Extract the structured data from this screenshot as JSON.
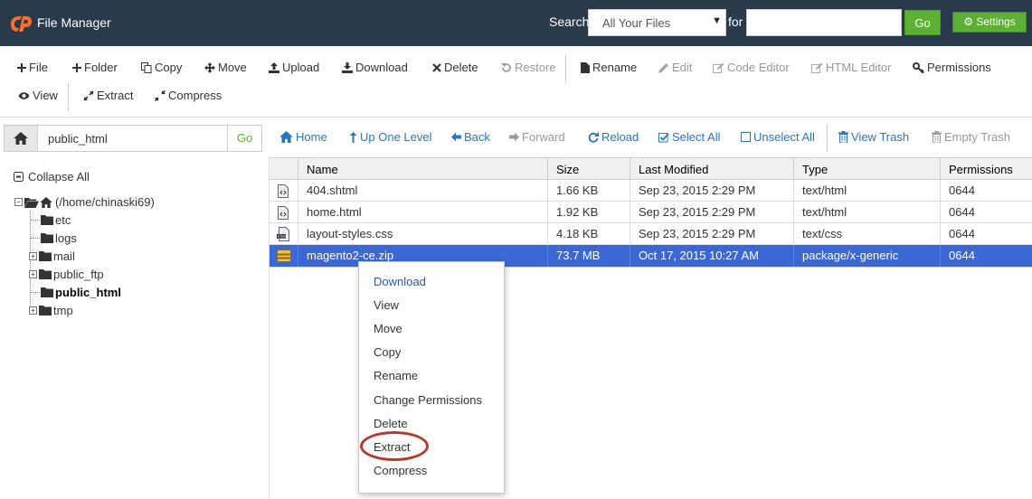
{
  "header": {
    "app_title": "File Manager",
    "search_label": "Search",
    "search_scope": "All Your Files",
    "for_label": "for",
    "search_value": "",
    "go_label": "Go",
    "settings_label": "Settings"
  },
  "toolbar": {
    "file": "File",
    "folder": "Folder",
    "copy": "Copy",
    "move": "Move",
    "upload": "Upload",
    "download": "Download",
    "delete": "Delete",
    "restore": "Restore",
    "rename": "Rename",
    "edit": "Edit",
    "code_editor": "Code Editor",
    "html_editor": "HTML Editor",
    "permissions": "Permissions",
    "view": "View",
    "extract": "Extract",
    "compress": "Compress"
  },
  "pathbar": {
    "path_value": "public_html",
    "go_label": "Go"
  },
  "nav": {
    "home": "Home",
    "up_one_level": "Up One Level",
    "back": "Back",
    "forward": "Forward",
    "reload": "Reload",
    "select_all": "Select All",
    "unselect_all": "Unselect All",
    "view_trash": "View Trash",
    "empty_trash": "Empty Trash"
  },
  "sidebar": {
    "collapse_all": "Collapse All",
    "root": "(/home/chinaski69)",
    "items": [
      {
        "label": "etc"
      },
      {
        "label": "logs"
      },
      {
        "label": "mail"
      },
      {
        "label": "public_ftp"
      },
      {
        "label": "public_html"
      },
      {
        "label": "tmp"
      }
    ]
  },
  "table": {
    "columns": [
      "Name",
      "Size",
      "Last Modified",
      "Type",
      "Permissions"
    ],
    "rows": [
      {
        "name": "404.shtml",
        "size": "1.66 KB",
        "modified": "Sep 23, 2015 2:29 PM",
        "type": "text/html",
        "perms": "0644"
      },
      {
        "name": "home.html",
        "size": "1.92 KB",
        "modified": "Sep 23, 2015 2:29 PM",
        "type": "text/html",
        "perms": "0644"
      },
      {
        "name": "layout-styles.css",
        "size": "4.18 KB",
        "modified": "Sep 23, 2015 2:29 PM",
        "type": "text/css",
        "perms": "0644"
      },
      {
        "name": "magento2-ce.zip",
        "size": "73.7 MB",
        "modified": "Oct 17, 2015 10:27 AM",
        "type": "package/x-generic",
        "perms": "0644"
      }
    ]
  },
  "context_menu": {
    "items": [
      "Download",
      "View",
      "Move",
      "Copy",
      "Rename",
      "Change Permissions",
      "Delete",
      "Extract",
      "Compress"
    ]
  }
}
